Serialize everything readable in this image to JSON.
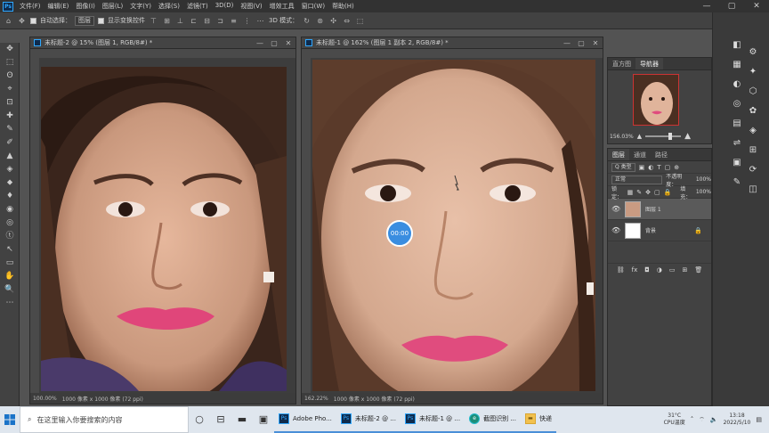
{
  "menubar": {
    "logo": "Ps",
    "items": [
      "文件(F)",
      "编辑(E)",
      "图像(I)",
      "图层(L)",
      "文字(Y)",
      "选择(S)",
      "滤镜(T)",
      "3D(D)",
      "视图(V)",
      "增效工具",
      "窗口(W)",
      "帮助(H)"
    ],
    "window_controls": [
      "—",
      "▢",
      "✕"
    ]
  },
  "options_bar": {
    "auto_select_label": "自动选择：",
    "auto_select_value": "图层",
    "transform_label": "显示变换控件",
    "mode_label": "3D 模式："
  },
  "tools": [
    "✥",
    "⬚",
    "ʘ",
    "⌖",
    "⊡",
    "✚",
    "✎",
    "✐",
    "▲",
    "◈",
    "⬥",
    "♦",
    "◉",
    "◎",
    "ⓣ",
    "↖",
    "▭",
    "✋",
    "🔍",
    "⋯"
  ],
  "doc1": {
    "title": "未标题-2 @ 15% (图层 1, RGB/8#) *",
    "zoom": "100.00%",
    "info": "1000 像素 x 1000 像素 (72 ppi)"
  },
  "doc2": {
    "title": "未标题-1 @ 162% (图层 1 副本 2, RGB/8#) *",
    "zoom": "162.22%",
    "info": "1000 像素 x 1000 像素 (72 ppi)"
  },
  "timer": "00:00",
  "navigator": {
    "tabs": [
      "直方图",
      "导航器"
    ],
    "zoom": "156.03%"
  },
  "layers": {
    "tabs": [
      "图层",
      "通道",
      "路径"
    ],
    "filter_label": "Q 类型",
    "blend_mode": "正常",
    "opacity_label": "不透明度：",
    "opacity": "100%",
    "lock_label": "锁定：",
    "fill_label": "填充：",
    "fill": "100%",
    "items": [
      {
        "name": "图层 1"
      },
      {
        "name": "背景"
      }
    ]
  },
  "taskbar": {
    "search_placeholder": "在这里输入你要搜索的内容",
    "apps": [
      "Adobe Pho...",
      "未标题-2 @ ...",
      "未标题-1 @ ...",
      "截图识别 ...",
      "快递"
    ],
    "weather_temp": "31°C",
    "weather_label": "CPU温度",
    "time": "13:18",
    "date": "2022/5/10"
  },
  "colors": {
    "accent": "#31a8ff",
    "panel_bg": "#424242",
    "workspace_bg": "#535353"
  }
}
